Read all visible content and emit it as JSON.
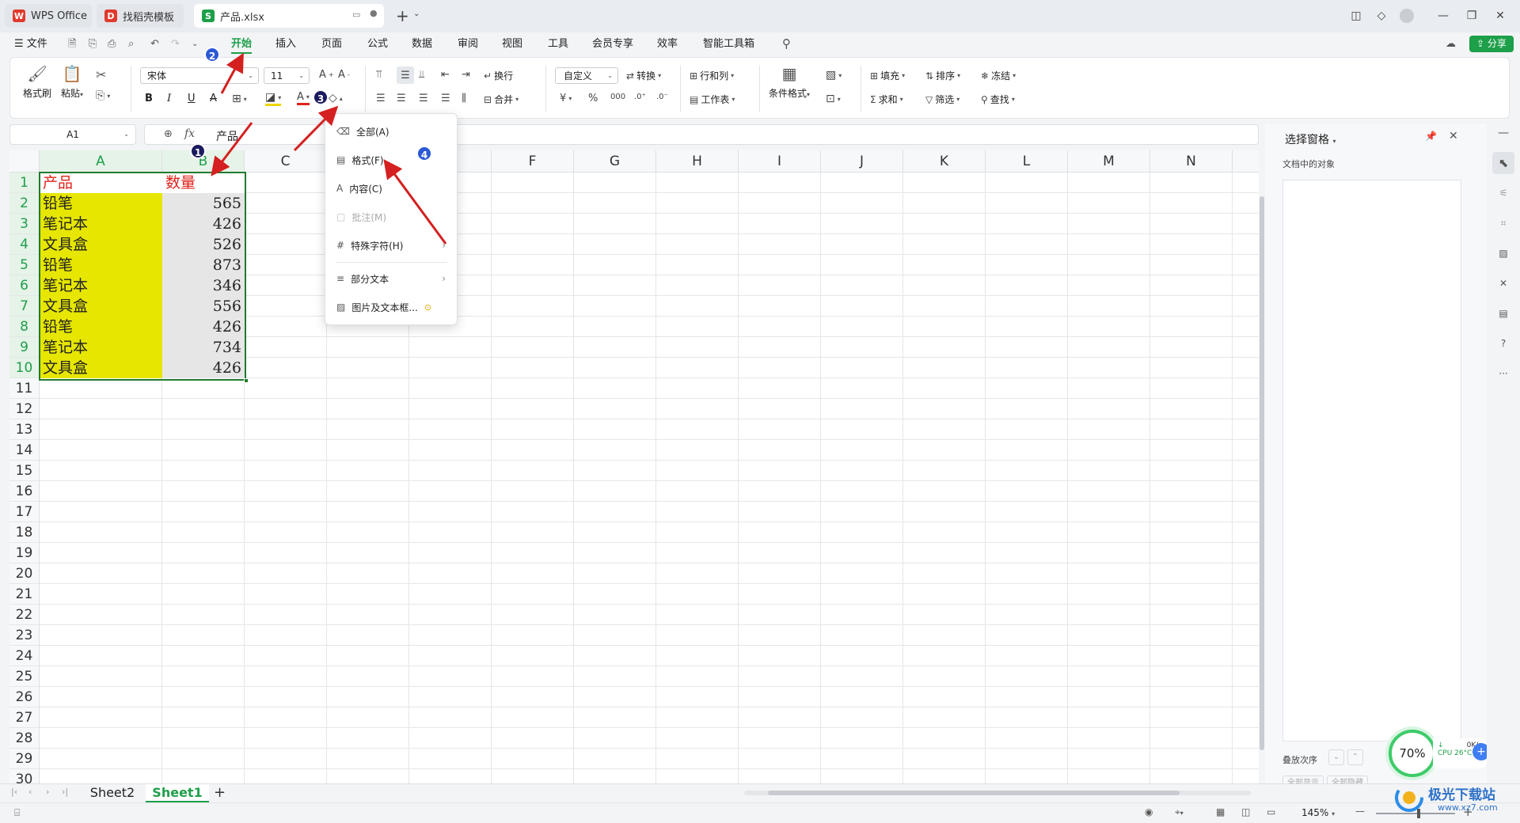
{
  "tabs": [
    {
      "label": "WPS Office"
    },
    {
      "label": "找稻壳模板"
    },
    {
      "label": "产品.xlsx"
    }
  ],
  "menu": {
    "file": "文件",
    "items": [
      "开始",
      "插入",
      "页面",
      "公式",
      "数据",
      "审阅",
      "视图",
      "工具",
      "会员专享",
      "效率",
      "智能工具箱"
    ],
    "active": "开始",
    "share": "分享"
  },
  "ribbon": {
    "format_painter": "格式刷",
    "paste": "粘贴",
    "font_name": "宋体",
    "font_size": "11",
    "wrap": "换行",
    "merge": "合并",
    "number_format": "自定义",
    "convert": "转换",
    "row_col": "行和列",
    "worksheet": "工作表",
    "cond_format": "条件格式",
    "fill": "填充",
    "sort": "排序",
    "freeze": "冻结",
    "sum": "求和",
    "filter": "筛选",
    "find": "查找",
    "currency": "¥",
    "percent": "%"
  },
  "formula_bar": {
    "name_box": "A1",
    "fx": "fx",
    "content": "产品"
  },
  "columns": [
    "A",
    "B",
    "C",
    "D",
    "E",
    "F",
    "G",
    "H",
    "I",
    "J",
    "K",
    "L",
    "M",
    "N"
  ],
  "rows": [
    "1",
    "2",
    "3",
    "4",
    "5",
    "6",
    "7",
    "8",
    "9",
    "10",
    "11",
    "12",
    "13",
    "14",
    "15",
    "16",
    "17",
    "18",
    "19",
    "20",
    "21",
    "22",
    "23",
    "24",
    "25",
    "26",
    "27",
    "28",
    "29",
    "30"
  ],
  "cells": [
    [
      "产品",
      "数量"
    ],
    [
      "铅笔",
      "565"
    ],
    [
      "笔记本",
      "426"
    ],
    [
      "文具盒",
      "526"
    ],
    [
      "铅笔",
      "873"
    ],
    [
      "笔记本",
      "346"
    ],
    [
      "文具盒",
      "556"
    ],
    [
      "铅笔",
      "426"
    ],
    [
      "笔记本",
      "734"
    ],
    [
      "文具盒",
      "426"
    ]
  ],
  "clear_menu": {
    "items": [
      {
        "label": "全部(A)",
        "enabled": true
      },
      {
        "label": "格式(F)",
        "enabled": true
      },
      {
        "label": "内容(C)",
        "enabled": true
      },
      {
        "label": "批注(M)",
        "enabled": false
      },
      {
        "label": "特殊字符(H)",
        "enabled": true
      },
      {
        "label": "部分文本",
        "enabled": true
      },
      {
        "label": "图片及文本框...",
        "enabled": true
      }
    ]
  },
  "sheets": {
    "tabs": [
      "Sheet2",
      "Sheet1"
    ],
    "active": "Sheet1",
    "add": "+"
  },
  "right_panel": {
    "title": "选择窗格",
    "subtitle": "文档中的对象",
    "order_label": "叠放次序",
    "show_all": "全部显示",
    "hide_all": "全部隐藏"
  },
  "status": {
    "zoom": "145%",
    "cpu_percent": "70%",
    "net_speed": "0K/s",
    "cpu_temp": "CPU 26°C"
  },
  "annotations": [
    "1",
    "2",
    "3",
    "4"
  ],
  "watermark": "极光下载站",
  "watermark_url": "www.xz7.com",
  "colors": {
    "accent_green": "#1e9f4a",
    "header_red": "#e0221b",
    "cell_yellow": "#e6e600",
    "cell_gray": "#e6e6e6",
    "selection": "#227a2f",
    "arrow_red": "#d42020"
  }
}
